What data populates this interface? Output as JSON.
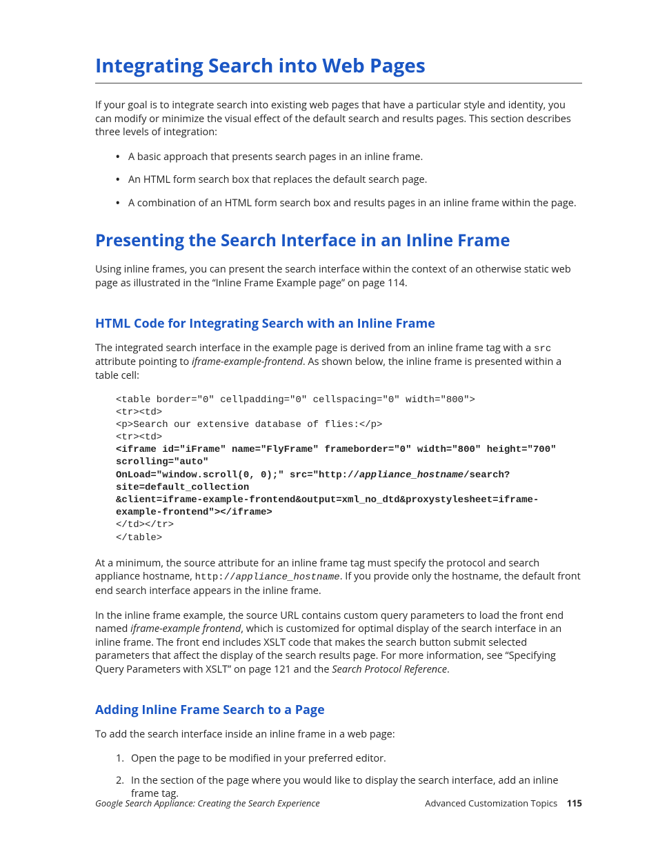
{
  "h1": "Integrating Search into Web Pages",
  "intro": "If your goal is to integrate search into existing web pages that have a particular style and identity, you can modify or minimize the visual effect of the default search and results pages. This section describes three levels of integration:",
  "bullets": [
    "A basic approach that presents search pages in an inline frame.",
    "An HTML form search box that replaces the default search page.",
    "A combination of an HTML form search box and results pages in an inline frame within the page."
  ],
  "h2": "Presenting the Search Interface in an Inline Frame",
  "p2": "Using inline frames, you can present the search interface within the context of an otherwise static web page as illustrated in the “Inline Frame Example page” on page 114.",
  "h3a": "HTML Code for Integrating Search with an Inline Frame",
  "p3a_pre": "The integrated search interface in the example page is derived from an inline frame tag with a ",
  "p3a_code": "src",
  "p3a_mid": " attribute pointing to ",
  "p3a_ital": "iframe-example-frontend",
  "p3a_post": ". As shown below, the inline frame is presented within a table cell:",
  "code": {
    "l1": "<table border=\"0\" cellpadding=\"0\" cellspacing=\"0\" width=\"800\">",
    "l2": "<tr><td>",
    "l3": "<p>Search our extensive database of flies:</p>",
    "l4": "<tr><td>",
    "l5a": "<iframe id=\"iFrame\" name=\"FlyFrame\" frameborder=\"0\" width=\"800\" height=\"700\" scrolling=\"auto\"",
    "l6a": "OnLoad=\"window.scroll(0, 0);\" src=\"http://",
    "l6i": "appliance_hostname",
    "l6b": "/search?site=default_collection",
    "l7": "&client=iframe-example-frontend&output=xml_no_dtd&proxystylesheet=iframe-example-frontend\"></iframe>",
    "l8": "</td></tr>",
    "l9": "</table>"
  },
  "p4_pre": "At a minimum, the source attribute for an inline frame tag must specify the protocol and search appliance hostname, ",
  "p4_code1": "http://",
  "p4_code_ital": "appliance_hostname",
  "p4_post": ". If you provide only the hostname, the default front end search interface appears in the inline frame.",
  "p5_pre": "In the inline frame example, the source URL contains custom query parameters to load the front end named ",
  "p5_ital": "iframe-example frontend",
  "p5_mid": ", which is customized for optimal display of the search interface in an inline frame. The front end includes XSLT code that makes the search button submit selected parameters that affect the display of the search results page. For more information, see “Specifying Query Parameters with XSLT” on page 121 and the ",
  "p5_ital2": "Search Protocol Reference",
  "p5_post": ".",
  "h3b": "Adding Inline Frame Search to a Page",
  "p6": "To add the search interface inside an inline frame in a web page:",
  "steps": [
    "Open the page to be modified in your preferred editor.",
    "In the section of the page where you would like to display the search interface, add an inline frame tag."
  ],
  "footer_left": "Google Search Appliance: Creating the Search Experience",
  "footer_right": "Advanced Customization Topics",
  "page_num": "115"
}
